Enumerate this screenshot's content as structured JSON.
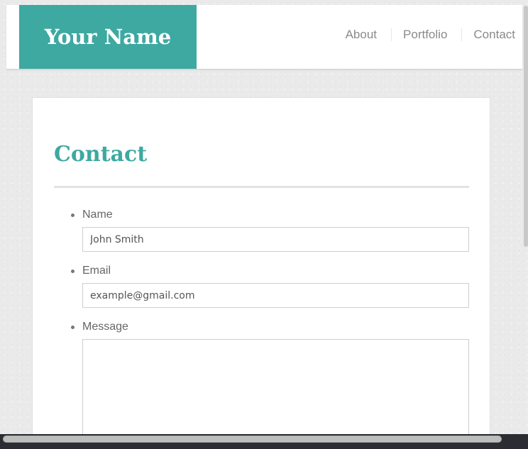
{
  "header": {
    "logo_text": "Your Name",
    "nav": [
      {
        "label": "About"
      },
      {
        "label": "Portfolio"
      },
      {
        "label": "Contact"
      }
    ]
  },
  "main": {
    "title": "Contact",
    "form": {
      "name": {
        "label": "Name",
        "placeholder": "John Smith"
      },
      "email": {
        "label": "Email",
        "placeholder": "example@gmail.com"
      },
      "message": {
        "label": "Message",
        "placeholder": ""
      }
    }
  },
  "colors": {
    "accent": "#3ea9a1",
    "background": "#eaeaea"
  }
}
